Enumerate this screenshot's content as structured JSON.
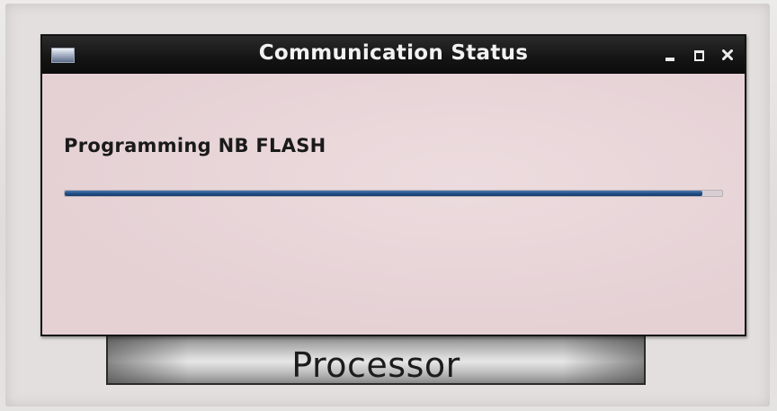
{
  "window": {
    "title": "Communication Status"
  },
  "dialog": {
    "status_message": "Programming NB FLASH",
    "progress_fraction": 0.97
  },
  "background": {
    "processor_button_label": "Processor"
  },
  "icons": {
    "window_menu": "window-menu-icon",
    "minimize": "minimize-icon",
    "maximize": "maximize-icon",
    "close": "close-icon"
  },
  "colors": {
    "titlebar": "#141414",
    "dialog_background": "#e5d1d4",
    "progress_fill": "#1f4e86",
    "title_text": "#f2f2f2"
  }
}
